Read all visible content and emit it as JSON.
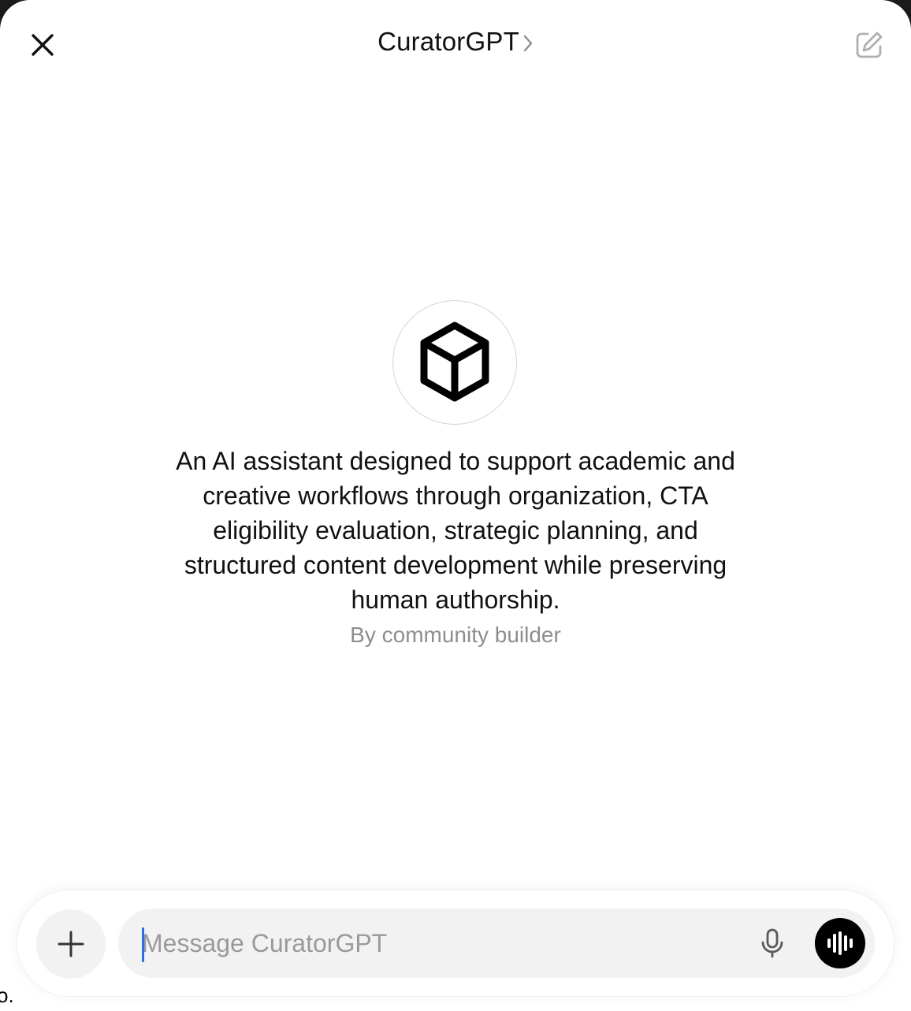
{
  "header": {
    "title": "CuratorGPT",
    "close_icon": "close-icon",
    "chevron_icon": "chevron-right-icon",
    "edit_icon": "new-chat-edit-icon"
  },
  "gpt": {
    "avatar_icon": "cube-icon",
    "description": "An AI assistant designed to support academic and creative workflows through organization, CTA eligibility evaluation, strategic planning, and structured content development while preserving human authorship.",
    "byline": "By community builder"
  },
  "composer": {
    "placeholder": "Message CuratorGPT",
    "value": "",
    "plus_icon": "plus-icon",
    "mic_icon": "microphone-icon",
    "voice_icon": "voice-mode-icon"
  },
  "corner_text": "o."
}
